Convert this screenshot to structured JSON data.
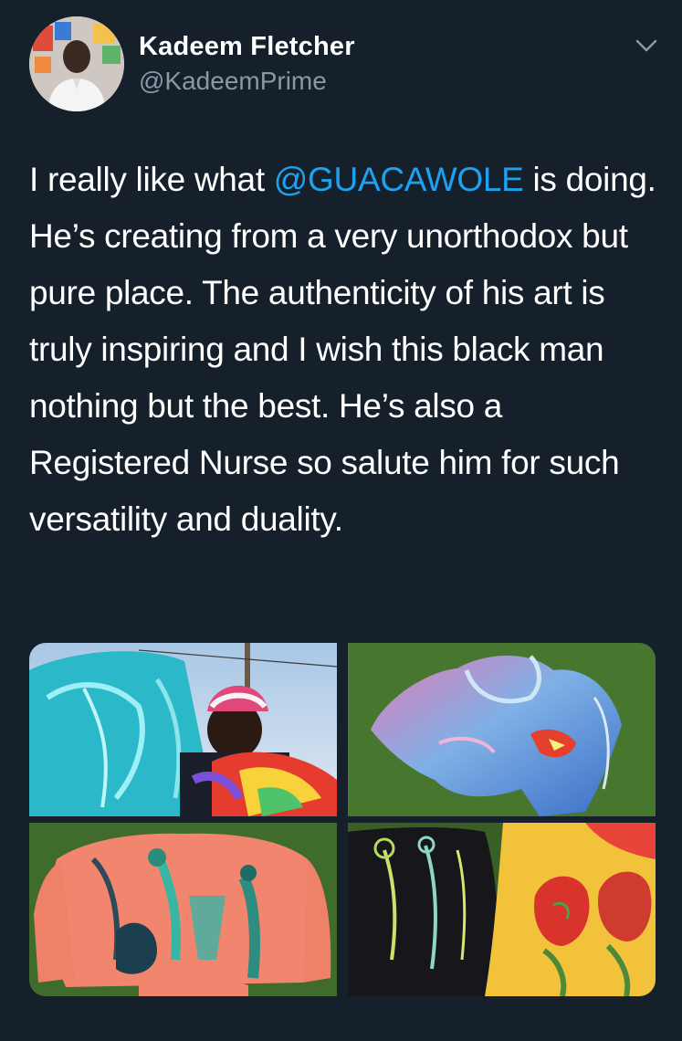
{
  "tweet": {
    "author": {
      "display_name": "Kadeem Fletcher",
      "handle": "@KadeemPrime"
    },
    "text": {
      "before_mention": "I really like what ",
      "mention": "@GUACAWOLE",
      "after_mention": " is doing. He’s creating from a very unorthodox but pure place. The authenticity of his art is truly inspiring and I wish this black man nothing but the best. He’s also a Registered Nurse so salute him for such versatility and duality."
    },
    "menu_icon": "chevron-down-icon",
    "media": [
      {
        "icon": "photo",
        "description": ""
      },
      {
        "icon": "photo",
        "description": ""
      },
      {
        "icon": "photo",
        "description": ""
      },
      {
        "icon": "photo",
        "description": ""
      }
    ]
  },
  "colors": {
    "background": "#15202b",
    "text_primary": "#ffffff",
    "text_secondary": "#8899a6",
    "link": "#1da1f2"
  }
}
